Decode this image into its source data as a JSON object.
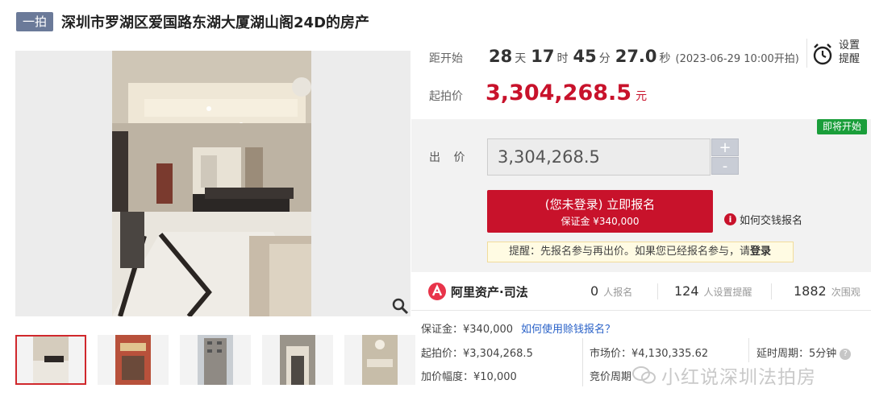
{
  "header": {
    "badge": "一拍",
    "title": "深圳市罗湖区爱国路东湖大厦湖山阁24D的房产"
  },
  "countdown": {
    "label": "距开始",
    "days": "28",
    "days_unit": "天",
    "hours": "17",
    "hours_unit": "时",
    "minutes": "45",
    "minutes_unit": "分",
    "seconds": "27.0",
    "seconds_unit": "秒",
    "start_note": "(2023-06-29 10:00开拍)"
  },
  "reminder": {
    "label": "设置提醒",
    "icon": "alarm-clock-icon"
  },
  "starting_price": {
    "label": "起拍价",
    "value": "3,304,268.5",
    "unit": "元",
    "color": "#c8122b"
  },
  "bid": {
    "status_tag": "即将开始",
    "label": "出 价",
    "input_value": "3,304,268.5",
    "plus": "+",
    "minus": "-",
    "signup_main": "(您未登录) 立即报名",
    "signup_sub": "保证金 ¥340,000",
    "howto_link": "如何交钱报名",
    "tip_text": "提醒：先报名参与再出价。如果您已经报名参与，请",
    "tip_login": "登录"
  },
  "stats": {
    "brand": "阿里资产·司法",
    "signups": "0",
    "signups_label": "人报名",
    "reminders": "124",
    "reminders_label": "人设置提醒",
    "views": "1882",
    "views_label": "次围观"
  },
  "details": {
    "deposit": "保证金：¥340,000",
    "deposit_link": "如何使用赊钱报名？",
    "start_price": "起拍价：¥3,304,268.5",
    "market_price": "市场价：¥4,130,335.62",
    "delay_period": "延时周期：5分钟",
    "increment": "加价幅度：¥10,000",
    "bidding_period": "竞价周期"
  },
  "watermark": "小红说深圳法拍房",
  "thumbnails": [
    "living-room",
    "storefront",
    "building-exterior",
    "entrance-lobby",
    "dining-room"
  ]
}
